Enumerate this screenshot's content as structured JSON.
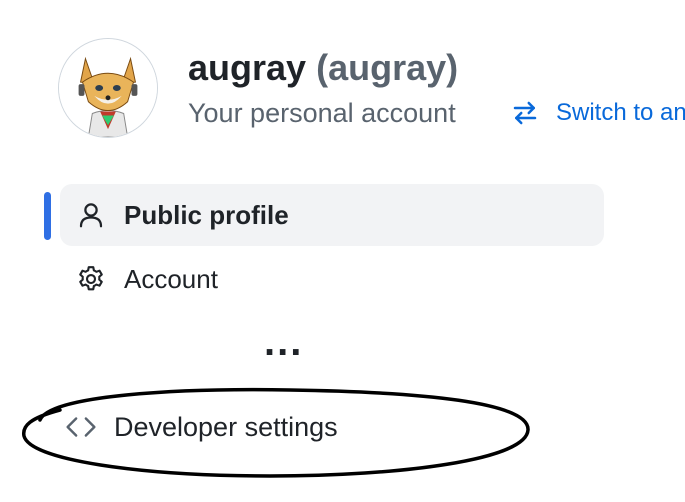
{
  "header": {
    "display_name": "augray",
    "login": "(augray)",
    "subtitle": "Your personal account",
    "switch_label": "Switch to an",
    "avatar_icon": "fox-avatar",
    "switch_icon": "arrow-switch-icon"
  },
  "nav": {
    "items": [
      {
        "label": "Public profile",
        "icon": "person-icon",
        "active": true
      },
      {
        "label": "Account",
        "icon": "gear-icon",
        "active": false
      }
    ],
    "more": "...",
    "developer": {
      "label": "Developer settings",
      "icon": "code-icon"
    }
  },
  "colors": {
    "accent": "#0969da",
    "indicator": "#2f6fe4",
    "muted": "#59636e",
    "active_bg": "#f2f3f5"
  }
}
